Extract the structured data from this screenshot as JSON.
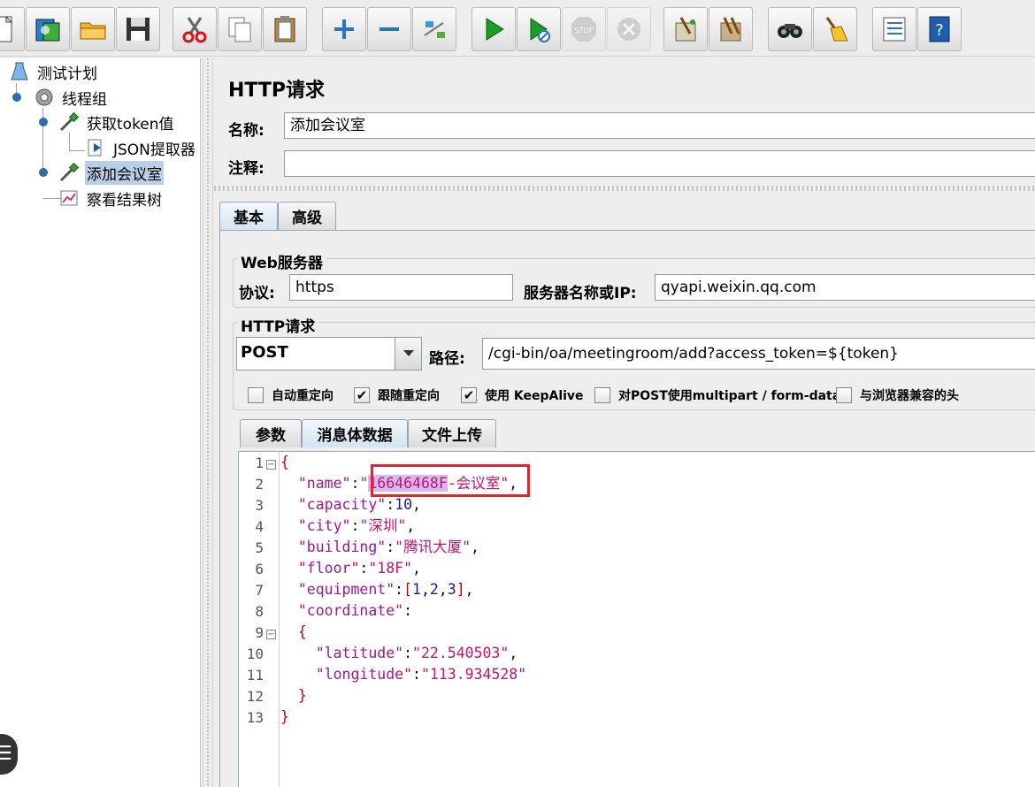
{
  "toolbar": {
    "buttons": [
      {
        "name": "new-icon",
        "enabled": true
      },
      {
        "name": "templates-icon",
        "enabled": true
      },
      {
        "name": "open-icon",
        "enabled": true
      },
      {
        "name": "save-icon",
        "enabled": true
      },
      {
        "name": "cut-icon",
        "enabled": true
      },
      {
        "name": "copy-icon",
        "enabled": true
      },
      {
        "name": "paste-icon",
        "enabled": true
      },
      {
        "name": "expand-icon",
        "enabled": true
      },
      {
        "name": "collapse-icon",
        "enabled": true
      },
      {
        "name": "toggle-icon",
        "enabled": true
      },
      {
        "name": "start-icon",
        "enabled": true
      },
      {
        "name": "start-no-pause-icon",
        "enabled": true
      },
      {
        "name": "stop-icon",
        "enabled": false
      },
      {
        "name": "shutdown-icon",
        "enabled": false
      },
      {
        "name": "clear-icon",
        "enabled": true
      },
      {
        "name": "clear-all-icon",
        "enabled": true
      },
      {
        "name": "search-icon",
        "enabled": true
      },
      {
        "name": "reset-search-icon",
        "enabled": true
      },
      {
        "name": "function-helper-icon",
        "enabled": true
      },
      {
        "name": "help-icon",
        "enabled": true
      }
    ]
  },
  "tree": {
    "test_plan": "测试计划",
    "thread_group": "线程组",
    "get_token": "获取token值",
    "json_extractor": "JSON提取器",
    "add_room": "添加会议室",
    "results_tree": "察看结果树"
  },
  "panel": {
    "title": "HTTP请求",
    "name_label": "名称:",
    "name_value": "添加会议室",
    "comment_label": "注释:",
    "comment_value": ""
  },
  "tabs": {
    "basic": "基本",
    "advanced": "高级"
  },
  "web_server": {
    "title": "Web服务器",
    "protocol_label": "协议:",
    "protocol_value": "https",
    "server_label": "服务器名称或IP:",
    "server_value": "qyapi.weixin.qq.com"
  },
  "http_request": {
    "title": "HTTP请求",
    "method": "POST",
    "path_label": "路径:",
    "path_value": "/cgi-bin/oa/meetingroom/add?access_token=${token}"
  },
  "options": {
    "auto_redirect": {
      "label": "自动重定向",
      "checked": false
    },
    "follow_redirect": {
      "label": "跟随重定向",
      "checked": true
    },
    "keepalive": {
      "label": "使用 KeepAlive",
      "checked": true
    },
    "multipart": {
      "label": "对POST使用multipart / form-data",
      "checked": false
    },
    "browser_headers": {
      "label": "与浏览器兼容的头",
      "checked": false
    }
  },
  "subtabs": {
    "params": "参数",
    "body": "消息体数据",
    "files": "文件上传"
  },
  "body": {
    "line_numbers": [
      "1",
      "2",
      "3",
      "4",
      "5",
      "6",
      "7",
      "8",
      "9",
      "10",
      "11",
      "12",
      "13"
    ],
    "highlighted": "16646468F",
    "l1_open": "{",
    "l2_key": "\"name\"",
    "l2_colon": ":",
    "l2_q1": "\"",
    "l2_rest": "-会议室",
    "l2_q2": "\"",
    "l2_comma": ",",
    "l3_key": "\"capacity\"",
    "l3_val": "10",
    "l4_key": "\"city\"",
    "l4_val": "\"深圳\"",
    "l5_key": "\"building\"",
    "l5_val": "\"腾讯大厦\"",
    "l6_key": "\"floor\"",
    "l6_val": "\"18F\"",
    "l7_key": "\"equipment\"",
    "l7_lb": "[",
    "l7_v1": "1",
    "l7_v2": "2",
    "l7_v3": "3",
    "l7_rb": "]",
    "l8_key": "\"coordinate\"",
    "l9_open": "{",
    "l10_key": "\"latitude\"",
    "l10_val": "\"22.540503\"",
    "l11_key": "\"longitude\"",
    "l11_val": "\"113.934528\"",
    "l12_close": "}",
    "l13_close": "}"
  }
}
